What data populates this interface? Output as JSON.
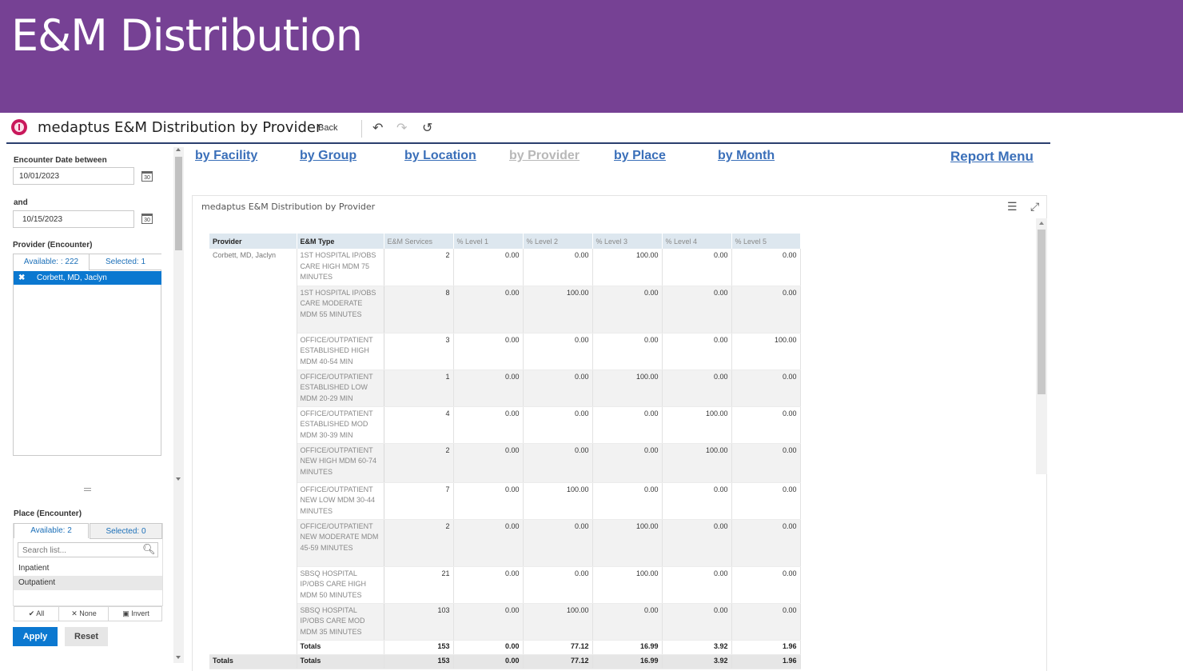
{
  "slide": {
    "title": "E&M Distribution"
  },
  "header": {
    "app_title": "medaptus E&M Distribution by Provider",
    "back_label": "Back"
  },
  "filters": {
    "date_label": "Encounter Date between",
    "date_from": "10/01/2023",
    "and_label": "and",
    "date_to": "10/15/2023",
    "calendar_glyph": "30",
    "provider": {
      "label": "Provider (Encounter)",
      "available": "Available: :  222",
      "selected": "Selected:  1",
      "items": [
        "Corbett, MD, Jaclyn"
      ]
    },
    "place": {
      "label": "Place (Encounter)",
      "available": "Available: 2",
      "selected": "Selected: 0",
      "search_placeholder": "Search list...",
      "items": [
        "Inpatient",
        "Outpatient"
      ]
    },
    "actions": {
      "all": "All",
      "none": "None",
      "invert": "Invert"
    },
    "apply_label": "Apply",
    "reset_label": "Reset"
  },
  "nav": {
    "links": [
      "by Facility",
      "by Group",
      "by Location",
      "by Provider",
      "by Place",
      "by Month"
    ],
    "active": "by Provider",
    "report_menu": "Report Menu"
  },
  "report": {
    "title": "medaptus E&M Distribution by Provider",
    "columns": [
      "Provider",
      "E&M Type",
      "E&M Services",
      "% Level 1",
      "% Level 2",
      "% Level 3",
      "% Level 4",
      "% Level 5"
    ],
    "provider": "Corbett, MD, Jaclyn",
    "rows": [
      {
        "type": "1ST HOSPITAL IP/OBS CARE HIGH MDM 75 MINUTES",
        "services": "2",
        "l1": "0.00",
        "l2": "0.00",
        "l3": "100.00",
        "l4": "0.00",
        "l5": "0.00"
      },
      {
        "type": "1ST HOSPITAL IP/OBS CARE MODERATE MDM 55 MINUTES",
        "services": "8",
        "l1": "0.00",
        "l2": "100.00",
        "l3": "0.00",
        "l4": "0.00",
        "l5": "0.00"
      },
      {
        "type": "OFFICE/OUTPATIENT ESTABLISHED HIGH MDM 40-54 MIN",
        "services": "3",
        "l1": "0.00",
        "l2": "0.00",
        "l3": "0.00",
        "l4": "0.00",
        "l5": "100.00"
      },
      {
        "type": "OFFICE/OUTPATIENT ESTABLISHED LOW MDM 20-29 MIN",
        "services": "1",
        "l1": "0.00",
        "l2": "0.00",
        "l3": "100.00",
        "l4": "0.00",
        "l5": "0.00"
      },
      {
        "type": "OFFICE/OUTPATIENT ESTABLISHED MOD MDM 30-39 MIN",
        "services": "4",
        "l1": "0.00",
        "l2": "0.00",
        "l3": "0.00",
        "l4": "100.00",
        "l5": "0.00"
      },
      {
        "type": "OFFICE/OUTPATIENT NEW HIGH MDM 60-74 MINUTES",
        "services": "2",
        "l1": "0.00",
        "l2": "0.00",
        "l3": "0.00",
        "l4": "100.00",
        "l5": "0.00"
      },
      {
        "type": "OFFICE/OUTPATIENT NEW LOW MDM 30-44 MINUTES",
        "services": "7",
        "l1": "0.00",
        "l2": "100.00",
        "l3": "0.00",
        "l4": "0.00",
        "l5": "0.00"
      },
      {
        "type": "OFFICE/OUTPATIENT NEW MODERATE MDM 45-59 MINUTES",
        "services": "2",
        "l1": "0.00",
        "l2": "0.00",
        "l3": "100.00",
        "l4": "0.00",
        "l5": "0.00"
      },
      {
        "type": "SBSQ HOSPITAL IP/OBS CARE HIGH MDM 50 MINUTES",
        "services": "21",
        "l1": "0.00",
        "l2": "0.00",
        "l3": "100.00",
        "l4": "0.00",
        "l5": "0.00"
      },
      {
        "type": "SBSQ HOSPITAL IP/OBS CARE MOD MDM 35 MINUTES",
        "services": "103",
        "l1": "0.00",
        "l2": "100.00",
        "l3": "0.00",
        "l4": "0.00",
        "l5": "0.00"
      }
    ],
    "provider_totals": {
      "label": "Totals",
      "services": "153",
      "l1": "0.00",
      "l2": "77.12",
      "l3": "16.99",
      "l4": "3.92",
      "l5": "1.96"
    },
    "grand_totals": {
      "provider": "Totals",
      "label": "Totals",
      "services": "153",
      "l1": "0.00",
      "l2": "77.12",
      "l3": "16.99",
      "l4": "3.92",
      "l5": "1.96"
    }
  }
}
